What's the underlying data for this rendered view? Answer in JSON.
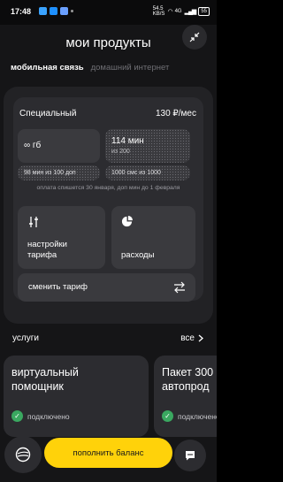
{
  "status_bar": {
    "time": "17:48",
    "net_speed": "54.5\nKB/S",
    "network": "4G",
    "battery": "55"
  },
  "header": {
    "title": "мои продукты"
  },
  "tabs": [
    {
      "label": "мобильная связь",
      "active": true
    },
    {
      "label": "домашний интернет",
      "active": false
    }
  ],
  "tariff": {
    "name": "Специальный",
    "price": "130 ₽/мес",
    "internet": "∞ гб",
    "minutes_main": "114 мин",
    "minutes_sub": "из 200",
    "extra_minutes": "98 мин из 100 доп",
    "sms": "1000 смс из 1000",
    "payment_note": "оплата спишется 30 января, доп мин до 1 февраля"
  },
  "actions": {
    "settings_line1": "настройки",
    "settings_line2": "тарифа",
    "spending": "расходы",
    "change_tariff": "сменить тариф"
  },
  "services": {
    "title": "услуги",
    "all_label": "все",
    "items": [
      {
        "name_line1": "виртуальный",
        "name_line2": "помощник",
        "status": "подключено"
      },
      {
        "name_line1": "Пакет 300",
        "name_line2": "автопрод",
        "status": "подключено"
      }
    ]
  },
  "bottom": {
    "topup_label": "пополнить баланс"
  },
  "colors": {
    "accent": "#ffd20a",
    "success": "#3aa860",
    "background": "#151517"
  }
}
